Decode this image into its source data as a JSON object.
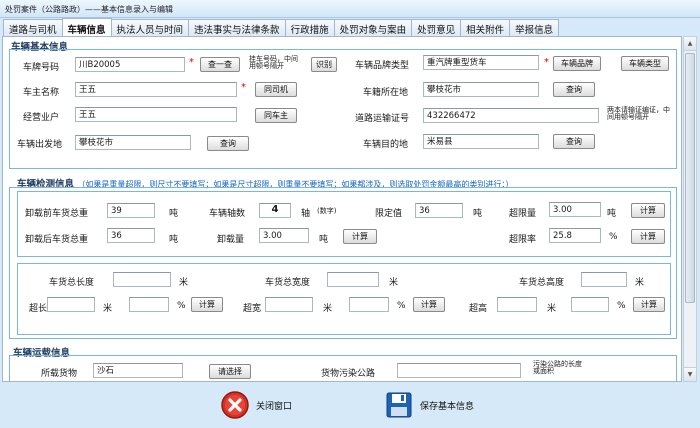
{
  "window": {
    "title": "处罚案件（公路路政）——基本信息录入与编辑"
  },
  "tabs": [
    "道路与司机",
    "车辆信息",
    "执法人员与时间",
    "违法事实与法律条款",
    "行政措施",
    "处罚对象与案由",
    "处罚意见",
    "相关附件",
    "举报信息"
  ],
  "vehicle_basic": {
    "title": "车辆基本信息",
    "plate_label": "车牌号码",
    "plate_value": "川B20005",
    "lookup_btn": "查一查",
    "plate_hint": "挂车号码，中间用顿号隔开",
    "recognize_btn": "识别",
    "brand_type_label": "车辆品牌类型",
    "brand_type_value": "重汽牌重型货车",
    "brand_btn": "车辆品牌",
    "type_btn": "车辆类型",
    "owner_label": "车主名称",
    "owner_value": "王五",
    "same_driver_btn": "同司机",
    "reg_place_label": "车籍所在地",
    "reg_place_value": "攀枝花市",
    "query_btn1": "查询",
    "operator_label": "经营业户",
    "operator_value": "王五",
    "same_owner_btn": "同车主",
    "transport_cert_label": "道路运输证号",
    "transport_cert_value": "432266472",
    "transport_cert_hint": "两本请输证编证，中间用顿号隔开",
    "departure_label": "车辆出发地",
    "departure_value": "攀枝花市",
    "query_btn2": "查询",
    "destination_label": "车辆目的地",
    "destination_value": "米易县",
    "query_btn3": "查询"
  },
  "detection": {
    "title": "车辆检测信息",
    "hint": "（如果是重量超限，则尺寸不要填写；如果是尺寸超限，则重量不要填写；如果都涉及，则选取处罚金额最高的类别进行：）",
    "gross_before_label": "卸载前车货总重",
    "gross_before_value": "39",
    "unit_ton": "吨",
    "axles_label": "车辆轴数",
    "axles_value": "4",
    "axle_unit": "轴",
    "axle_note": "(数字)",
    "limit_label": "限定值",
    "limit_value": "36",
    "overload_label": "超限量",
    "overload_value": "3.00",
    "calc_btn": "计算",
    "gross_after_label": "卸载后车货总重",
    "gross_after_value": "36",
    "unload_label": "卸载量",
    "unload_value": "3.00",
    "overload_rate_label": "超限率",
    "overload_rate_value": "25.8",
    "percent": "%",
    "length_label": "车货总长度",
    "width_label": "车货总宽度",
    "height_label": "车货总高度",
    "unit_m": "米",
    "over_length_label": "超长",
    "over_width_label": "超宽",
    "over_height_label": "超高"
  },
  "transport": {
    "title": "车辆运载信息",
    "cargo_label": "所载货物",
    "cargo_value": "沙石",
    "select_btn": "请选择",
    "pollution_label": "货物污染公路",
    "pollution_note": "污染公路的长度或面积"
  },
  "footer": {
    "close_label": "关闭窗口",
    "save_label": "保存基本信息"
  }
}
